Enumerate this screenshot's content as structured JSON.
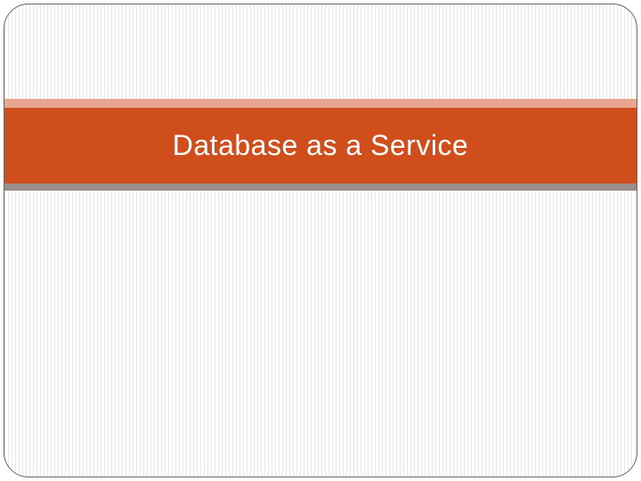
{
  "slide": {
    "title": "Database as a Service",
    "colors": {
      "titleBarBg": "#cf4e1c",
      "topAccent": "#e8a58f",
      "bottomAccent": "#9b8e8a",
      "titleText": "#ffffff"
    }
  }
}
